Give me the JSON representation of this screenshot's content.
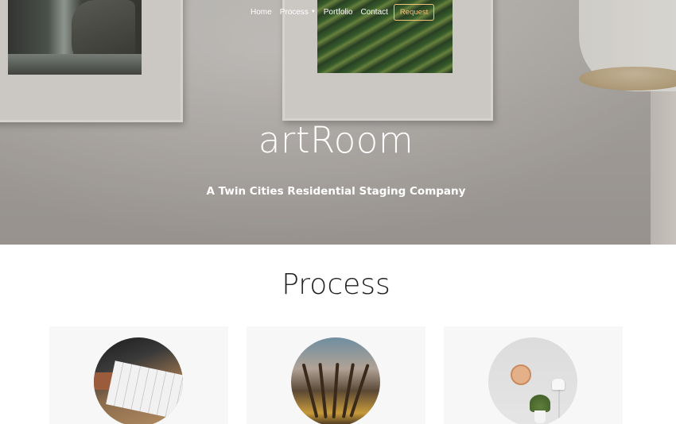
{
  "nav": {
    "links": [
      {
        "label": "Home"
      },
      {
        "label": "Process",
        "has_dropdown": true
      },
      {
        "label": "Portfolio"
      },
      {
        "label": "Contact"
      }
    ],
    "cta_label": "Request",
    "cta_color": "#f3c27c"
  },
  "hero": {
    "title": "artRoom",
    "subtitle": "A Twin Cities Residential Staging Company"
  },
  "process": {
    "title": "Process",
    "cards": [
      {
        "image": "sketching-drawing-photo"
      },
      {
        "image": "paint-brushes-photo"
      },
      {
        "image": "minimal-room-clock-plant-photo"
      }
    ]
  }
}
